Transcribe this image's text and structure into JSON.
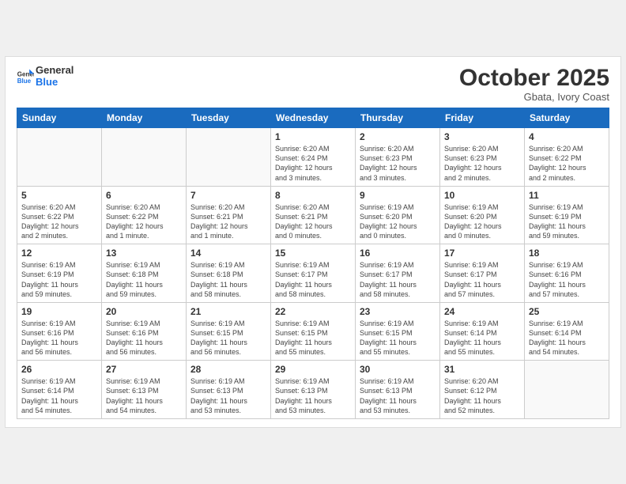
{
  "header": {
    "logo_general": "General",
    "logo_blue": "Blue",
    "month_title": "October 2025",
    "subtitle": "Gbata, Ivory Coast"
  },
  "weekdays": [
    "Sunday",
    "Monday",
    "Tuesday",
    "Wednesday",
    "Thursday",
    "Friday",
    "Saturday"
  ],
  "weeks": [
    [
      {
        "day": "",
        "info": ""
      },
      {
        "day": "",
        "info": ""
      },
      {
        "day": "",
        "info": ""
      },
      {
        "day": "1",
        "info": "Sunrise: 6:20 AM\nSunset: 6:24 PM\nDaylight: 12 hours\nand 3 minutes."
      },
      {
        "day": "2",
        "info": "Sunrise: 6:20 AM\nSunset: 6:23 PM\nDaylight: 12 hours\nand 3 minutes."
      },
      {
        "day": "3",
        "info": "Sunrise: 6:20 AM\nSunset: 6:23 PM\nDaylight: 12 hours\nand 2 minutes."
      },
      {
        "day": "4",
        "info": "Sunrise: 6:20 AM\nSunset: 6:22 PM\nDaylight: 12 hours\nand 2 minutes."
      }
    ],
    [
      {
        "day": "5",
        "info": "Sunrise: 6:20 AM\nSunset: 6:22 PM\nDaylight: 12 hours\nand 2 minutes."
      },
      {
        "day": "6",
        "info": "Sunrise: 6:20 AM\nSunset: 6:22 PM\nDaylight: 12 hours\nand 1 minute."
      },
      {
        "day": "7",
        "info": "Sunrise: 6:20 AM\nSunset: 6:21 PM\nDaylight: 12 hours\nand 1 minute."
      },
      {
        "day": "8",
        "info": "Sunrise: 6:20 AM\nSunset: 6:21 PM\nDaylight: 12 hours\nand 0 minutes."
      },
      {
        "day": "9",
        "info": "Sunrise: 6:19 AM\nSunset: 6:20 PM\nDaylight: 12 hours\nand 0 minutes."
      },
      {
        "day": "10",
        "info": "Sunrise: 6:19 AM\nSunset: 6:20 PM\nDaylight: 12 hours\nand 0 minutes."
      },
      {
        "day": "11",
        "info": "Sunrise: 6:19 AM\nSunset: 6:19 PM\nDaylight: 11 hours\nand 59 minutes."
      }
    ],
    [
      {
        "day": "12",
        "info": "Sunrise: 6:19 AM\nSunset: 6:19 PM\nDaylight: 11 hours\nand 59 minutes."
      },
      {
        "day": "13",
        "info": "Sunrise: 6:19 AM\nSunset: 6:18 PM\nDaylight: 11 hours\nand 59 minutes."
      },
      {
        "day": "14",
        "info": "Sunrise: 6:19 AM\nSunset: 6:18 PM\nDaylight: 11 hours\nand 58 minutes."
      },
      {
        "day": "15",
        "info": "Sunrise: 6:19 AM\nSunset: 6:17 PM\nDaylight: 11 hours\nand 58 minutes."
      },
      {
        "day": "16",
        "info": "Sunrise: 6:19 AM\nSunset: 6:17 PM\nDaylight: 11 hours\nand 58 minutes."
      },
      {
        "day": "17",
        "info": "Sunrise: 6:19 AM\nSunset: 6:17 PM\nDaylight: 11 hours\nand 57 minutes."
      },
      {
        "day": "18",
        "info": "Sunrise: 6:19 AM\nSunset: 6:16 PM\nDaylight: 11 hours\nand 57 minutes."
      }
    ],
    [
      {
        "day": "19",
        "info": "Sunrise: 6:19 AM\nSunset: 6:16 PM\nDaylight: 11 hours\nand 56 minutes."
      },
      {
        "day": "20",
        "info": "Sunrise: 6:19 AM\nSunset: 6:16 PM\nDaylight: 11 hours\nand 56 minutes."
      },
      {
        "day": "21",
        "info": "Sunrise: 6:19 AM\nSunset: 6:15 PM\nDaylight: 11 hours\nand 56 minutes."
      },
      {
        "day": "22",
        "info": "Sunrise: 6:19 AM\nSunset: 6:15 PM\nDaylight: 11 hours\nand 55 minutes."
      },
      {
        "day": "23",
        "info": "Sunrise: 6:19 AM\nSunset: 6:15 PM\nDaylight: 11 hours\nand 55 minutes."
      },
      {
        "day": "24",
        "info": "Sunrise: 6:19 AM\nSunset: 6:14 PM\nDaylight: 11 hours\nand 55 minutes."
      },
      {
        "day": "25",
        "info": "Sunrise: 6:19 AM\nSunset: 6:14 PM\nDaylight: 11 hours\nand 54 minutes."
      }
    ],
    [
      {
        "day": "26",
        "info": "Sunrise: 6:19 AM\nSunset: 6:14 PM\nDaylight: 11 hours\nand 54 minutes."
      },
      {
        "day": "27",
        "info": "Sunrise: 6:19 AM\nSunset: 6:13 PM\nDaylight: 11 hours\nand 54 minutes."
      },
      {
        "day": "28",
        "info": "Sunrise: 6:19 AM\nSunset: 6:13 PM\nDaylight: 11 hours\nand 53 minutes."
      },
      {
        "day": "29",
        "info": "Sunrise: 6:19 AM\nSunset: 6:13 PM\nDaylight: 11 hours\nand 53 minutes."
      },
      {
        "day": "30",
        "info": "Sunrise: 6:19 AM\nSunset: 6:13 PM\nDaylight: 11 hours\nand 53 minutes."
      },
      {
        "day": "31",
        "info": "Sunrise: 6:20 AM\nSunset: 6:12 PM\nDaylight: 11 hours\nand 52 minutes."
      },
      {
        "day": "",
        "info": ""
      }
    ]
  ]
}
